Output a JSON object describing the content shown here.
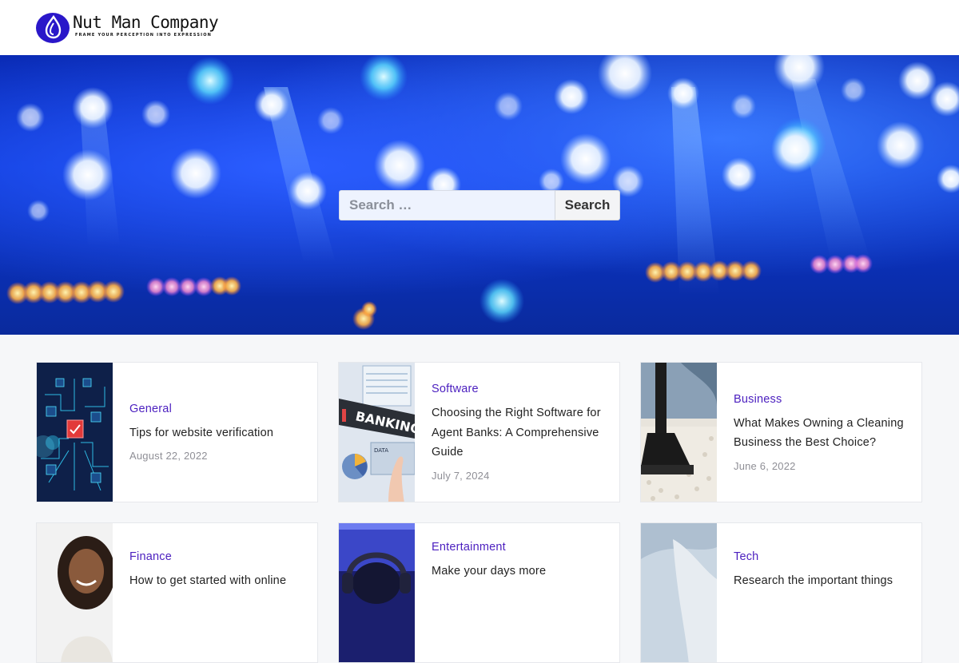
{
  "site": {
    "name": "Nut Man Company",
    "tagline": "Frame your perception into expression",
    "logo_icon": "drop-logo-icon",
    "accent": "#4b1fbf"
  },
  "search": {
    "placeholder": "Search …",
    "button_label": "Search"
  },
  "posts": [
    {
      "category": "General",
      "title": "Tips for website verification",
      "date": "August 22, 2022",
      "thumb": "circuit-board-image"
    },
    {
      "category": "Software",
      "title": "Choosing the Right Software for Agent Banks: A Comprehensive Guide",
      "date": "July 7, 2024",
      "thumb": "banking-screen-image"
    },
    {
      "category": "Business",
      "title": "What Makes Owning a Cleaning Business the Best Choice?",
      "date": "June 6, 2022",
      "thumb": "vacuum-carpet-image"
    },
    {
      "category": "Finance",
      "title": "How to get started with online",
      "date": "",
      "thumb": "smiling-woman-image"
    },
    {
      "category": "Entertainment",
      "title": "Make your days more",
      "date": "",
      "thumb": "headphones-image"
    },
    {
      "category": "Tech",
      "title": "Research the important things",
      "date": "",
      "thumb": "hand-image"
    }
  ]
}
